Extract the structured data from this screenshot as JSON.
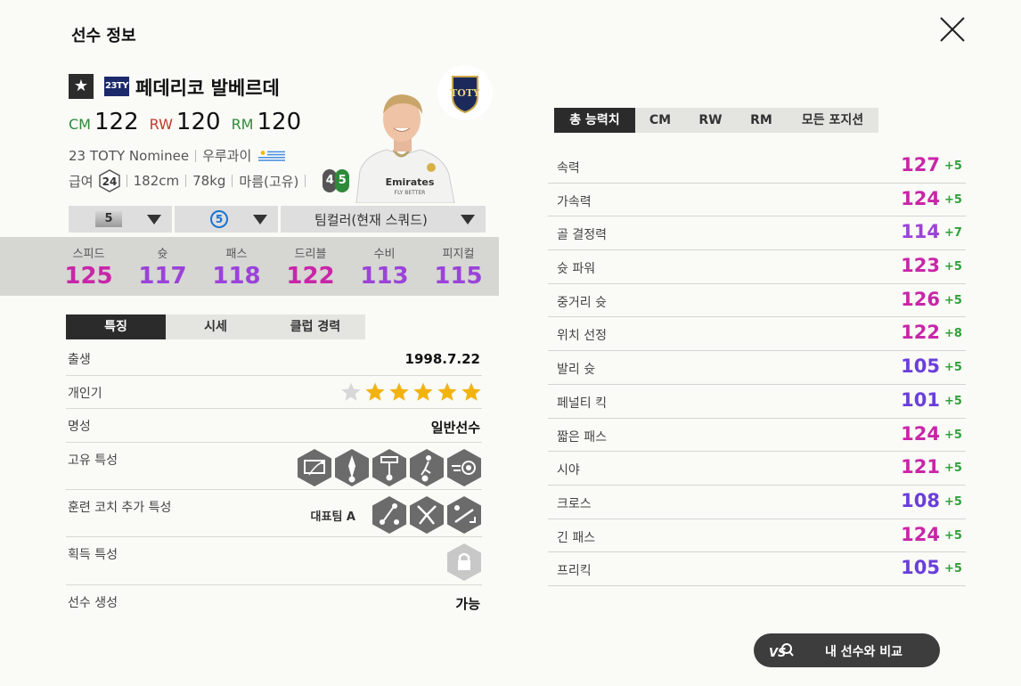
{
  "header": {
    "title": "선수 정보"
  },
  "player": {
    "season_badge": "23TY",
    "name": "페데리코 발베르데",
    "positions": [
      {
        "pos": "CM",
        "ovr": "122",
        "color": "#2f8a3a"
      },
      {
        "pos": "RW",
        "ovr": "120",
        "color": "#c0392b"
      },
      {
        "pos": "RM",
        "ovr": "120",
        "color": "#2f8a3a"
      }
    ],
    "season_name": "23 TOTY Nominee",
    "nationality": "우루과이",
    "pay_label": "급여",
    "pay": "24",
    "height": "182cm",
    "weight": "78kg",
    "body_type": "마름(고유)",
    "weak_foot_left": "4",
    "weak_foot_right": "5",
    "jersey_text_1": "Emirates",
    "jersey_text_2": "FLY BETTER",
    "team_logo_text": "TOTY"
  },
  "selectors": {
    "grade": "5",
    "enhance": "5",
    "team_color": "팀컬러(현재 스쿼드)"
  },
  "main_stats": [
    {
      "label": "스피드",
      "value": "125",
      "color": "#c826a8"
    },
    {
      "label": "슛",
      "value": "117",
      "color": "#9b43d9"
    },
    {
      "label": "패스",
      "value": "118",
      "color": "#9b43d9"
    },
    {
      "label": "드리블",
      "value": "122",
      "color": "#c826a8"
    },
    {
      "label": "수비",
      "value": "113",
      "color": "#9b43d9"
    },
    {
      "label": "피지컬",
      "value": "115",
      "color": "#9b43d9"
    }
  ],
  "left_tabs": [
    "특징",
    "시세",
    "클럽 경력"
  ],
  "info": {
    "birth_label": "출생",
    "birth": "1998.7.22",
    "popularity_label": "개인기",
    "popularity_stars": 5,
    "reputation_label": "명성",
    "reputation": "일반선수",
    "unique_traits_label": "고유 특성",
    "coach_traits_label": "훈련 코치 추가 특성",
    "coach_traits_tag": "대표팀 A",
    "acquired_traits_label": "획득 특성",
    "creation_label": "선수 생성",
    "creation": "가능"
  },
  "right_tabs": [
    "총 능력치",
    "CM",
    "RW",
    "RM",
    "모든 포지션"
  ],
  "detail_stats": [
    {
      "label": "속력",
      "value": "127",
      "bonus": "+5",
      "color": "#c826a8"
    },
    {
      "label": "가속력",
      "value": "124",
      "bonus": "+5",
      "color": "#c826a8"
    },
    {
      "label": "골 결정력",
      "value": "114",
      "bonus": "+7",
      "color": "#9b43d9"
    },
    {
      "label": "슛 파워",
      "value": "123",
      "bonus": "+5",
      "color": "#c826a8"
    },
    {
      "label": "중거리 슛",
      "value": "126",
      "bonus": "+5",
      "color": "#c826a8"
    },
    {
      "label": "위치 선정",
      "value": "122",
      "bonus": "+8",
      "color": "#c826a8"
    },
    {
      "label": "발리 슛",
      "value": "105",
      "bonus": "+5",
      "color": "#6a3fd9"
    },
    {
      "label": "페널티 킥",
      "value": "101",
      "bonus": "+5",
      "color": "#6a3fd9"
    },
    {
      "label": "짧은 패스",
      "value": "124",
      "bonus": "+5",
      "color": "#c826a8"
    },
    {
      "label": "시야",
      "value": "121",
      "bonus": "+5",
      "color": "#c826a8"
    },
    {
      "label": "크로스",
      "value": "108",
      "bonus": "+5",
      "color": "#6a3fd9"
    },
    {
      "label": "긴 패스",
      "value": "124",
      "bonus": "+5",
      "color": "#c826a8"
    },
    {
      "label": "프리킥",
      "value": "105",
      "bonus": "+5",
      "color": "#6a3fd9"
    }
  ],
  "compare_button": {
    "label": "내 선수와 비교"
  }
}
